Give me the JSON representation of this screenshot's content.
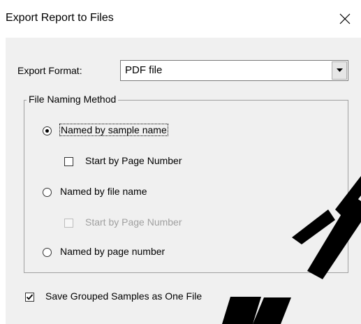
{
  "window": {
    "title": "Export Report to Files",
    "close_glyph": "✕"
  },
  "export_format": {
    "label": "Export Format:",
    "selected_value": "PDF file"
  },
  "naming_method": {
    "group_label": "File Naming Method",
    "options": [
      {
        "label": "Named by sample name",
        "selected": true,
        "focused": true
      },
      {
        "label": "Named by file name",
        "selected": false
      },
      {
        "label": "Named by page number",
        "selected": false
      }
    ],
    "start_by_page_sample": {
      "label": "Start by Page Number",
      "checked": false,
      "enabled": true
    },
    "start_by_page_file": {
      "label": "Start by Page Number",
      "checked": false,
      "enabled": false
    }
  },
  "save_grouped": {
    "label": "Save Grouped Samples as One File",
    "checked": true
  },
  "icons": {
    "close": "close-icon",
    "dropdown": "chevron-down-icon",
    "check": "check-icon"
  }
}
